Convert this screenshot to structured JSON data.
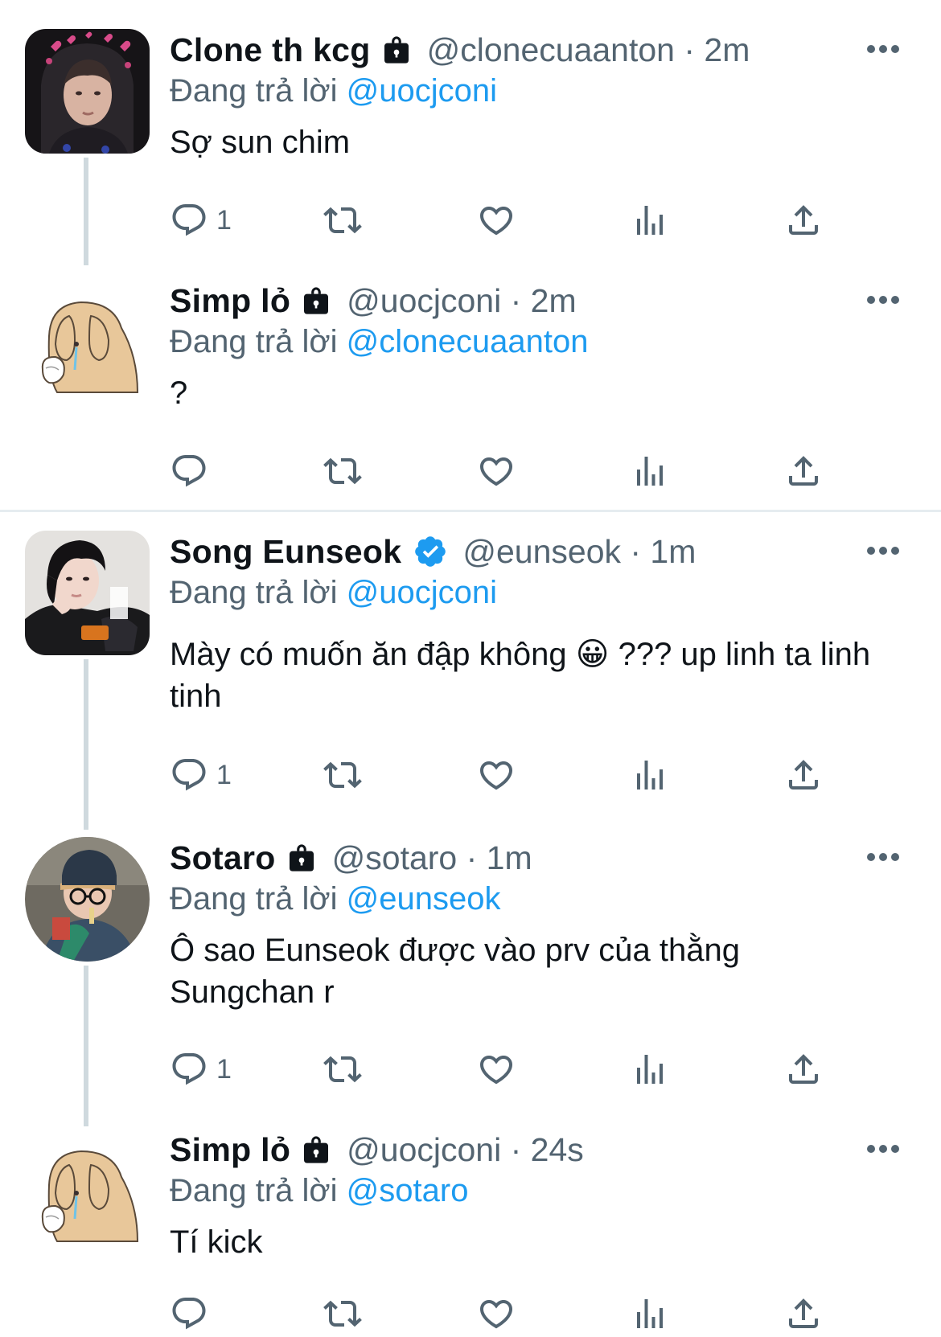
{
  "colors": {
    "link": "#1d9bf0",
    "muted": "#536471",
    "text": "#0f1419",
    "verified": "#1d9bf0"
  },
  "tweets": [
    {
      "name": "Clone th kcg",
      "handle_time": "@clonecuaanton · 2m",
      "reply_prefix": "Đang trả lời",
      "reply_to": "@uocjconi",
      "text": "Sợ sun chim",
      "reply_count": "1",
      "avatar": "hooded-person-avatar",
      "badge": "lock-icon"
    },
    {
      "name": "Simp lỏ",
      "handle_time": "@uocjconi · 2m",
      "reply_prefix": "Đang trả lời",
      "reply_to": "@clonecuaanton",
      "text": "?",
      "reply_count": "",
      "avatar": "crying-dog-cartoon-avatar",
      "badge": "lock-icon"
    },
    {
      "name": "Song Eunseok",
      "handle_time": "@eunseok · 1m",
      "reply_prefix": "Đang trả lời",
      "reply_to": "@uocjconi",
      "text": "Mày có muốn ăn đập không 😀 ??? up linh ta linh tinh",
      "reply_count": "1",
      "avatar": "young-man-jacket-avatar",
      "badge": "verified-badge-icon"
    },
    {
      "name": "Sotaro",
      "handle_time": "@sotaro · 1m",
      "reply_prefix": "Đang trả lời",
      "reply_to": "@eunseok",
      "text": "Ô sao Eunseok được vào prv của thằng Sungchan r",
      "reply_count": "1",
      "avatar": "cap-glasses-person-avatar",
      "badge": "lock-icon"
    },
    {
      "name": "Simp lỏ",
      "handle_time": "@uocjconi · 24s",
      "reply_prefix": "Đang trả lời",
      "reply_to": "@sotaro",
      "text": "Tí kick",
      "reply_count": "",
      "avatar": "crying-dog-cartoon-avatar",
      "badge": "lock-icon"
    }
  ]
}
